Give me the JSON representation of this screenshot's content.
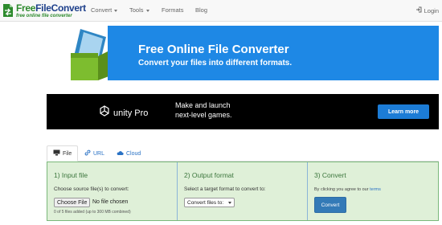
{
  "brand": {
    "name_prefix": "Free",
    "name_rest": "FileConvert",
    "tagline": "free online file converter"
  },
  "nav": {
    "items": [
      {
        "label": "Convert",
        "dropdown": true
      },
      {
        "label": "Tools",
        "dropdown": true
      },
      {
        "label": "Formats",
        "dropdown": false
      },
      {
        "label": "Blog",
        "dropdown": false
      }
    ],
    "login": "Login"
  },
  "hero": {
    "title": "Free Online File Converter",
    "subtitle": "Convert your files into different formats."
  },
  "ad": {
    "logo_text": "unity Pro",
    "line1": "Make and launch",
    "line2": "next-level games.",
    "cta": "Learn more"
  },
  "tabs": [
    {
      "label": "File",
      "icon": "monitor-icon",
      "active": true
    },
    {
      "label": "URL",
      "icon": "link-icon",
      "active": false
    },
    {
      "label": "Cloud",
      "icon": "cloud-icon",
      "active": false
    }
  ],
  "converter": {
    "input": {
      "title": "1) Input file",
      "instruction": "Choose source file(s) to convert:",
      "file_button": "Choose File",
      "file_status": "No file chosen",
      "count_text": "0 of 5 files added (up to 300 MB combined)"
    },
    "output": {
      "title": "2) Output format",
      "instruction": "Select a target format to convert to:",
      "select_value": "Convert files to:"
    },
    "convert": {
      "title": "3) Convert",
      "agree_prefix": "By clicking you agree to our",
      "terms_link": "terms",
      "button": "Convert"
    }
  },
  "colors": {
    "hero_bg": "#1e88e5",
    "panel_bg": "#dff0d8",
    "step_title": "#3c763d",
    "convert_button": "#337ab7",
    "ad_cta": "#1c7cd6"
  }
}
